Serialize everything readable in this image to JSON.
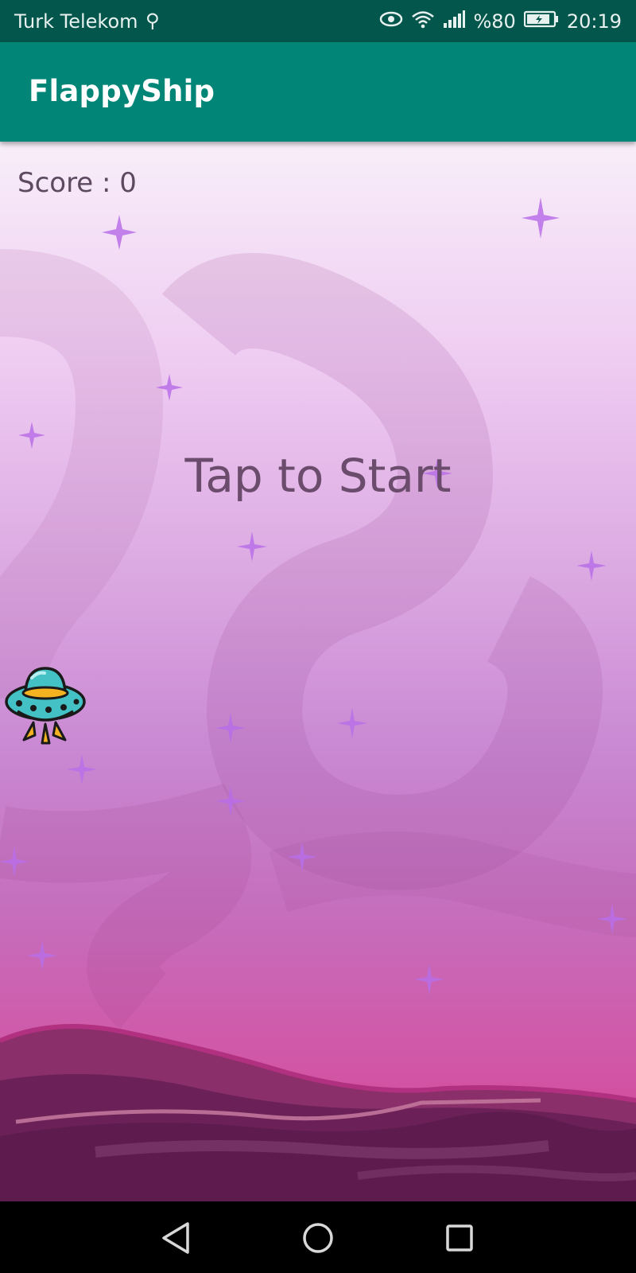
{
  "status_bar": {
    "carrier": "Turk Telekom",
    "battery_percent": "%80",
    "time": "20:19",
    "icons": [
      "usb-icon",
      "eye-icon",
      "wifi-icon",
      "signal-icon",
      "battery-icon"
    ]
  },
  "app_bar": {
    "title": "FlappyShip",
    "color": "#008577"
  },
  "game": {
    "score_text": "Score : 0",
    "prompt": "Tap to Start",
    "player": "ufo-ship-icon"
  },
  "nav_bar": {
    "icons": [
      "back-icon",
      "home-icon",
      "recents-icon"
    ]
  }
}
